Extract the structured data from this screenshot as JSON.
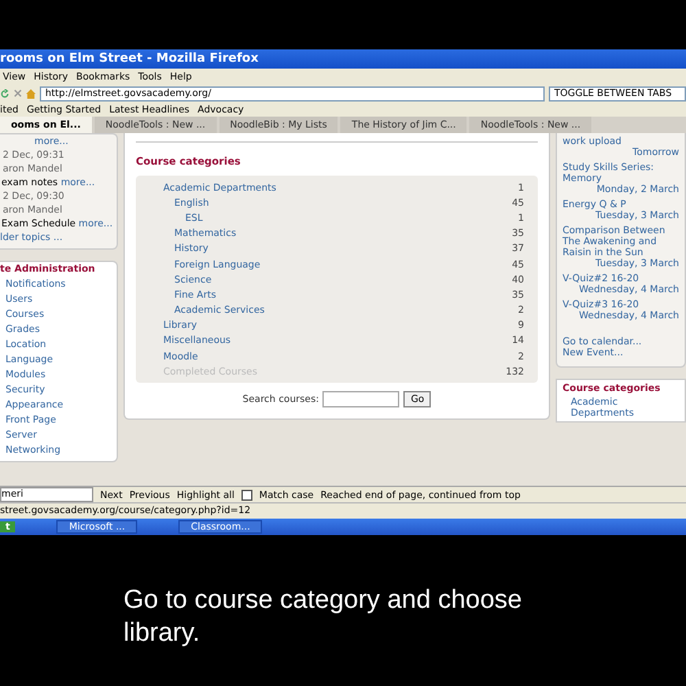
{
  "window": {
    "title": "rooms on Elm Street - Mozilla Firefox"
  },
  "menu": [
    "View",
    "History",
    "Bookmarks",
    "Tools",
    "Help"
  ],
  "address": {
    "value": "http://elmstreet.govsacademy.org/"
  },
  "search": {
    "value": "TOGGLE BETWEEN TABS"
  },
  "bookmarks": [
    "ited",
    "Getting Started",
    "Latest Headlines",
    "Advocacy"
  ],
  "tabs": [
    {
      "label": "ooms on El...",
      "selected": true
    },
    {
      "label": "NoodleTools : New ...",
      "selected": false
    },
    {
      "label": "NoodleBib : My Lists",
      "selected": false
    },
    {
      "label": "The History of Jim C...",
      "selected": false
    },
    {
      "label": "NoodleTools : New ...",
      "selected": false
    }
  ],
  "news": {
    "top_link": "more...",
    "posts": [
      {
        "date": "2 Dec, 09:31",
        "author": "aron Mandel",
        "subject": "exam notes",
        "link": "more..."
      },
      {
        "date": "2 Dec, 09:30",
        "author": "aron Mandel",
        "subject": "Exam Schedule",
        "link": "more..."
      }
    ],
    "older": "lder topics ..."
  },
  "admin": {
    "title": "te Administration",
    "items": [
      "Notifications",
      "Users",
      "Courses",
      "Grades",
      "Location",
      "Language",
      "Modules",
      "Security",
      "Appearance",
      "Front Page",
      "Server",
      "Networking"
    ]
  },
  "categories": {
    "title": "Course categories",
    "rows": [
      {
        "name": "Academic Departments",
        "count": "1",
        "dimmed": false,
        "children": [
          {
            "name": "English",
            "count": "45",
            "dimmed": false,
            "children": [
              {
                "name": "ESL",
                "count": "1",
                "dimmed": false
              }
            ]
          },
          {
            "name": "Mathematics",
            "count": "35",
            "dimmed": false
          },
          {
            "name": "History",
            "count": "37",
            "dimmed": false
          },
          {
            "name": "Foreign Language",
            "count": "45",
            "dimmed": false
          },
          {
            "name": "Science",
            "count": "40",
            "dimmed": false
          },
          {
            "name": "Fine Arts",
            "count": "35",
            "dimmed": false
          },
          {
            "name": "Academic Services",
            "count": "2",
            "dimmed": false
          }
        ]
      },
      {
        "name": "Library",
        "count": "9",
        "dimmed": false
      },
      {
        "name": "Miscellaneous",
        "count": "14",
        "dimmed": false
      },
      {
        "name": "Moodle",
        "count": "2",
        "dimmed": false
      },
      {
        "name": "Completed Courses",
        "count": "132",
        "dimmed": true
      }
    ],
    "search_label": "Search courses:",
    "go": "Go"
  },
  "events": [
    {
      "title": "work upload",
      "when": "Tomorrow"
    },
    {
      "title": "Study Skills Series: Memory",
      "when": "Monday, 2 March"
    },
    {
      "title": "Energy Q & P",
      "when": "Tuesday, 3 March"
    },
    {
      "title": "Comparison Between The Awakening and Raisin in the Sun",
      "when": "Tuesday, 3 March"
    },
    {
      "title": "V-Quiz#2 16-20",
      "when": "Wednesday, 4 March"
    },
    {
      "title": "V-Quiz#3 16-20",
      "when": "Wednesday, 4 March"
    }
  ],
  "calendar_links": [
    "Go to calendar...",
    "New Event..."
  ],
  "side_categories": {
    "title": "Course categories",
    "item": "Academic Departments"
  },
  "find": {
    "value": "meri",
    "next": "Next",
    "previous": "Previous",
    "highlight": "Highlight all",
    "match_case": {
      "label": "Match case",
      "checked": false
    },
    "message": "Reached end of page, continued from top"
  },
  "status": "street.govsacademy.org/course/category.php?id=12",
  "taskbar": {
    "start": "t",
    "items": [
      "Microsoft ...",
      "Classroom..."
    ]
  },
  "subtitle": "Go to course category and choose library."
}
